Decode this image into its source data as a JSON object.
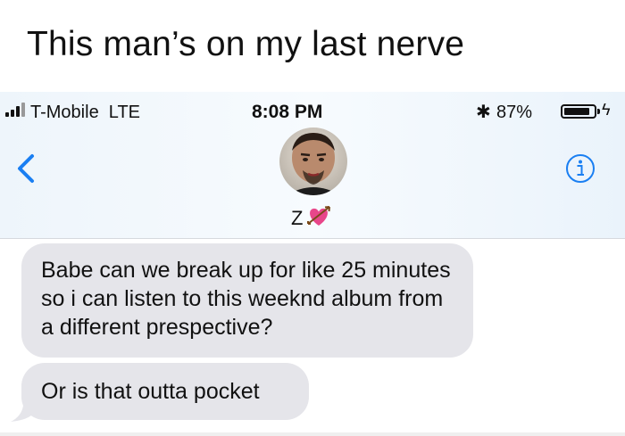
{
  "caption": "This man’s on my last nerve",
  "status_bar": {
    "carrier": "T-Mobile  LTE",
    "time": "8:08 PM",
    "bluetooth_glyph": "✱",
    "battery": "87%",
    "battery_level": 0.87,
    "charging_glyph": "ϟ"
  },
  "header": {
    "contact_name": "Z",
    "contact_emoji": "heart-with-arrow",
    "back_icon": "chevron-left-icon",
    "info_icon": "info-icon",
    "accent": "#1a7ff2"
  },
  "messages": [
    {
      "direction": "received",
      "text": "Babe can we break up for like 25 minutes so i can listen to this weeknd album from a different prespective?"
    },
    {
      "direction": "received",
      "text": "Or is that outta pocket"
    }
  ],
  "colors": {
    "bubble_received": "#e5e5ea",
    "heart": "#e8468a"
  }
}
